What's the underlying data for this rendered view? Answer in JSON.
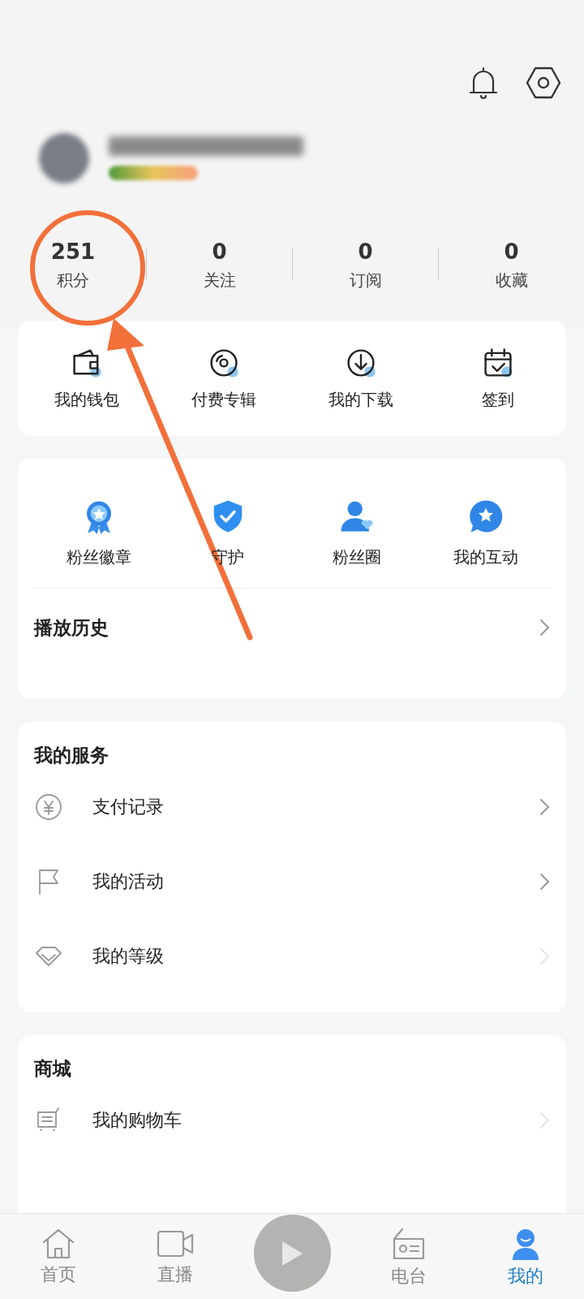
{
  "stats": [
    {
      "value": "251",
      "label": "积分"
    },
    {
      "value": "0",
      "label": "关注"
    },
    {
      "value": "0",
      "label": "订阅"
    },
    {
      "value": "0",
      "label": "收藏"
    }
  ],
  "shortcuts": [
    {
      "kind": "wallet",
      "label": "我的钱包"
    },
    {
      "kind": "disc",
      "label": "付费专辑"
    },
    {
      "kind": "download",
      "label": "我的下载"
    },
    {
      "kind": "calendar",
      "label": "签到"
    }
  ],
  "fan_features": [
    {
      "kind": "badge",
      "label": "粉丝徽章"
    },
    {
      "kind": "shield",
      "label": "守护"
    },
    {
      "kind": "fans",
      "label": "粉丝圈"
    },
    {
      "kind": "chat",
      "label": "我的互动"
    }
  ],
  "history": {
    "label": "播放历史"
  },
  "services": {
    "title": "我的服务",
    "items": [
      {
        "kind": "yuan",
        "label": "支付记录"
      },
      {
        "kind": "flag",
        "label": "我的活动"
      },
      {
        "kind": "diamond",
        "label": "我的等级"
      }
    ]
  },
  "mall": {
    "title": "商城",
    "items": [
      {
        "kind": "cart",
        "label": "我的购物车"
      }
    ]
  },
  "tab_bar": [
    {
      "kind": "home",
      "label": "首页",
      "selected": false
    },
    {
      "kind": "video",
      "label": "直播",
      "selected": false
    },
    {
      "kind": "play"
    },
    {
      "kind": "radio",
      "label": "电台",
      "selected": false
    },
    {
      "kind": "me",
      "label": "我的",
      "selected": true
    }
  ]
}
